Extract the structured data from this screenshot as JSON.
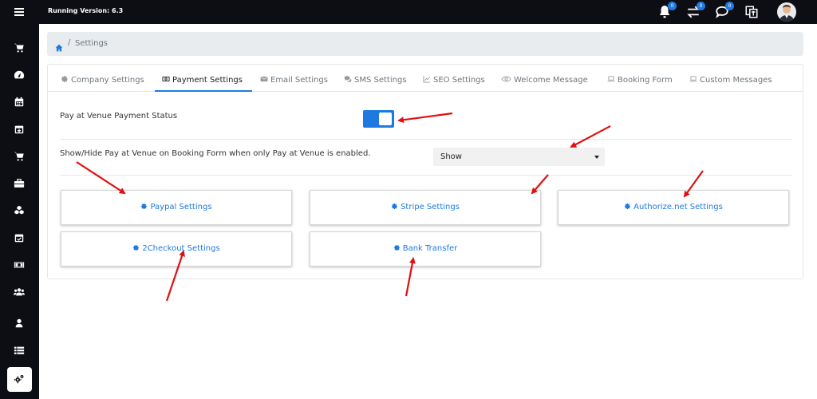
{
  "header": {
    "version": "Running Version: 6.3",
    "notifications": {
      "bell_count": "0",
      "transfer_count": "0",
      "chat_count": "0"
    }
  },
  "breadcrumb": {
    "current": "Settings",
    "separator": "/"
  },
  "tabs": [
    {
      "label": "Company Settings",
      "icon": "gear-icon"
    },
    {
      "label": "Payment Settings",
      "icon": "money-icon",
      "active": true
    },
    {
      "label": "Email Settings",
      "icon": "envelope-icon"
    },
    {
      "label": "SMS Settings",
      "icon": "comments-icon"
    },
    {
      "label": "SEO Settings",
      "icon": "chart-icon"
    },
    {
      "label": "Welcome Message",
      "icon": "eye-icon"
    },
    {
      "label": "Booking Form",
      "icon": "laptop-icon"
    },
    {
      "label": "Custom Messages",
      "icon": "laptop-icon"
    }
  ],
  "payment": {
    "pay_at_venue_label": "Pay at Venue Payment Status",
    "pay_at_venue_enabled": true,
    "show_hide_label": "Show/Hide Pay at Venue on Booking Form when only Pay at Venue is enabled.",
    "show_hide_value": "Show"
  },
  "gateways": {
    "paypal": "Paypal Settings",
    "stripe": "Stripe Settings",
    "authorize": "Authorize.net Settings",
    "twocheckout": "2Checkout Settings",
    "bank": "Bank Transfer"
  },
  "colors": {
    "accent": "#1e7ae0",
    "sidebar": "#0d0d14",
    "annotation": "#e01010"
  }
}
